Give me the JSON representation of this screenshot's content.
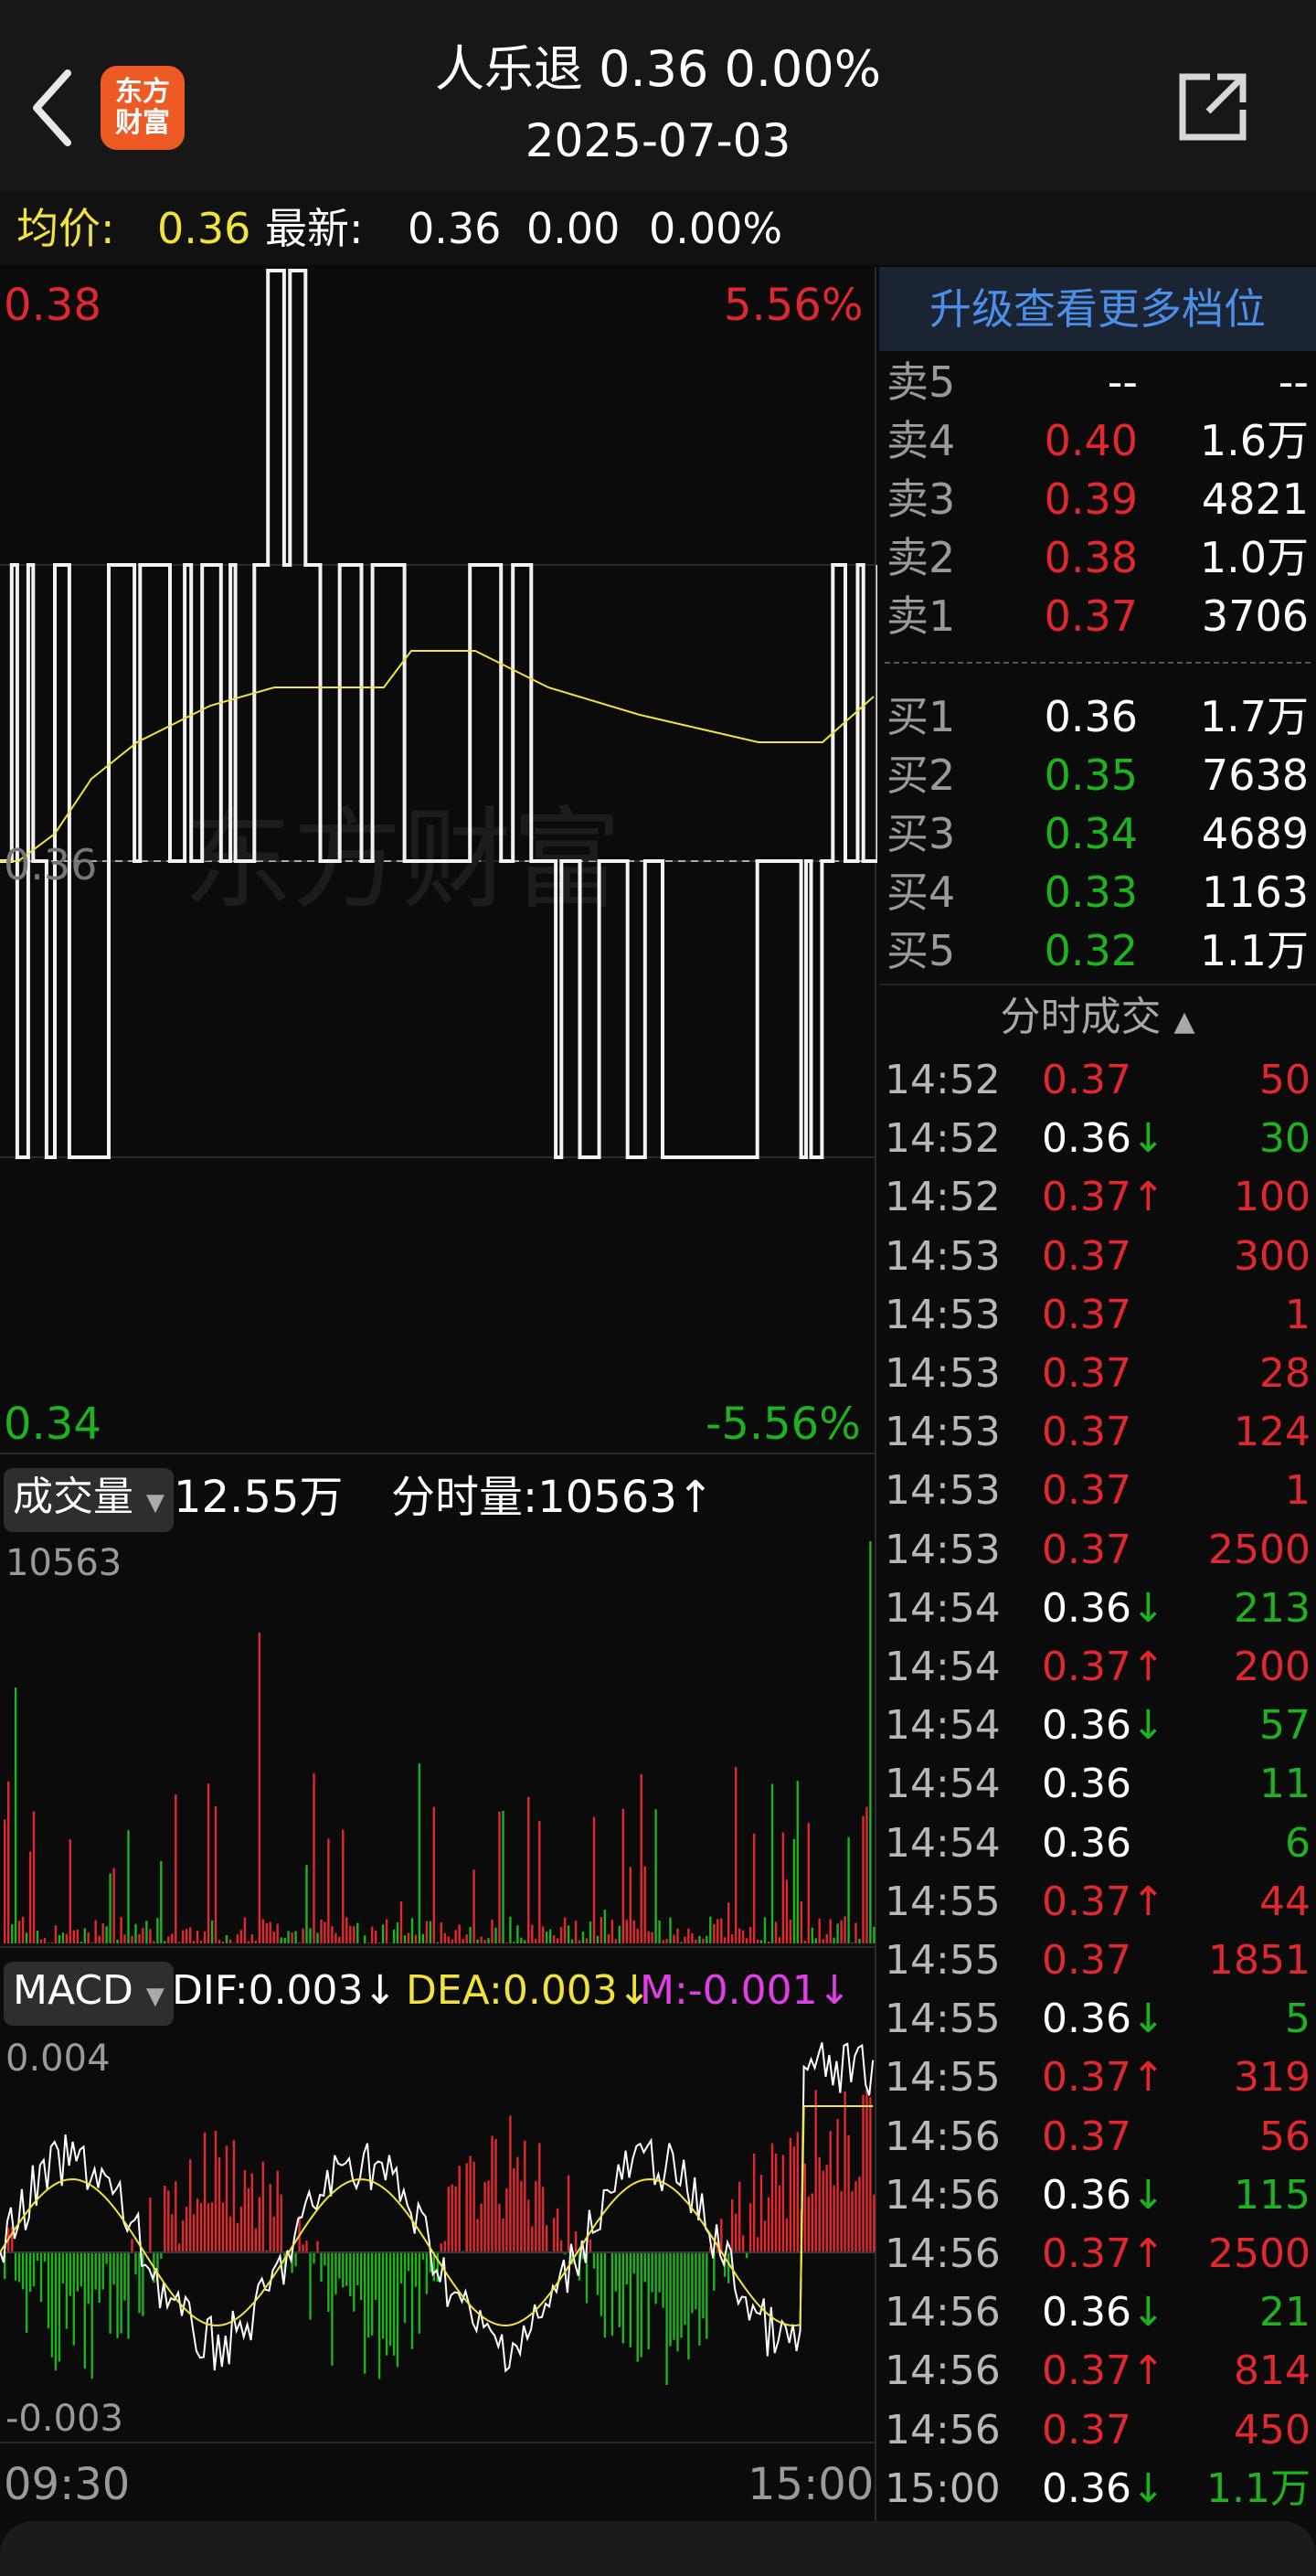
{
  "header": {
    "title": "人乐退  0.36  0.00%",
    "date": "2025-07-03",
    "logo_line1": "东方",
    "logo_line2": "财富",
    "back_icon": "chevron-left-icon",
    "share_icon": "share-external-icon"
  },
  "infobar": {
    "avg_label": "均价:",
    "avg_value": "0.36",
    "latest_label": "最新:",
    "latest_value": "0.36",
    "change": "0.00",
    "change_pct": "0.00%"
  },
  "price_chart": {
    "y_max_label": "0.38",
    "y_max_pct": "5.56%",
    "y_mid_label": "0.36",
    "y_min_label": "0.34",
    "y_min_pct": "-5.56%",
    "watermark": "东方财富"
  },
  "volume_panel": {
    "selector_label": "成交量",
    "total": "12.55万",
    "minute_volume": "分时量:10563↑",
    "max_label": "10563"
  },
  "macd_panel": {
    "selector_label": "MACD",
    "dif": "DIF:0.003↓",
    "dea": "DEA:0.003↓",
    "m": "M:-0.001↓",
    "max_label": "0.004",
    "min_label": "-0.003"
  },
  "time_axis": {
    "start": "09:30",
    "end": "15:00"
  },
  "order_book": {
    "upgrade_label": "升级查看更多档位",
    "asks": [
      {
        "label": "卖5",
        "price": "--",
        "volume": "--"
      },
      {
        "label": "卖4",
        "price": "0.40",
        "volume": "1.6万"
      },
      {
        "label": "卖3",
        "price": "0.39",
        "volume": "4821"
      },
      {
        "label": "卖2",
        "price": "0.38",
        "volume": "1.0万"
      },
      {
        "label": "卖1",
        "price": "0.37",
        "volume": "3706"
      }
    ],
    "bids": [
      {
        "label": "买1",
        "price": "0.36",
        "volume": "1.7万"
      },
      {
        "label": "买2",
        "price": "0.35",
        "volume": "7638"
      },
      {
        "label": "买3",
        "price": "0.34",
        "volume": "4689"
      },
      {
        "label": "买4",
        "price": "0.33",
        "volume": "1163"
      },
      {
        "label": "买5",
        "price": "0.32",
        "volume": "1.1万"
      }
    ]
  },
  "trades": {
    "header": "分时成交",
    "rows": [
      {
        "time": "14:52",
        "price": "0.37",
        "dir": "",
        "volume": "50",
        "color": "red"
      },
      {
        "time": "14:52",
        "price": "0.36",
        "dir": "↓",
        "volume": "30",
        "color": "green"
      },
      {
        "time": "14:52",
        "price": "0.37",
        "dir": "↑",
        "volume": "100",
        "color": "red"
      },
      {
        "time": "14:53",
        "price": "0.37",
        "dir": "",
        "volume": "300",
        "color": "red"
      },
      {
        "time": "14:53",
        "price": "0.37",
        "dir": "",
        "volume": "1",
        "color": "red"
      },
      {
        "time": "14:53",
        "price": "0.37",
        "dir": "",
        "volume": "28",
        "color": "red"
      },
      {
        "time": "14:53",
        "price": "0.37",
        "dir": "",
        "volume": "124",
        "color": "red"
      },
      {
        "time": "14:53",
        "price": "0.37",
        "dir": "",
        "volume": "1",
        "color": "red"
      },
      {
        "time": "14:53",
        "price": "0.37",
        "dir": "",
        "volume": "2500",
        "color": "red"
      },
      {
        "time": "14:54",
        "price": "0.36",
        "dir": "↓",
        "volume": "213",
        "color": "green"
      },
      {
        "time": "14:54",
        "price": "0.37",
        "dir": "↑",
        "volume": "200",
        "color": "red"
      },
      {
        "time": "14:54",
        "price": "0.36",
        "dir": "↓",
        "volume": "57",
        "color": "green"
      },
      {
        "time": "14:54",
        "price": "0.36",
        "dir": "",
        "volume": "11",
        "color": "green"
      },
      {
        "time": "14:54",
        "price": "0.36",
        "dir": "",
        "volume": "6",
        "color": "green"
      },
      {
        "time": "14:55",
        "price": "0.37",
        "dir": "↑",
        "volume": "44",
        "color": "red"
      },
      {
        "time": "14:55",
        "price": "0.37",
        "dir": "",
        "volume": "1851",
        "color": "red"
      },
      {
        "time": "14:55",
        "price": "0.36",
        "dir": "↓",
        "volume": "5",
        "color": "green"
      },
      {
        "time": "14:55",
        "price": "0.37",
        "dir": "↑",
        "volume": "319",
        "color": "red"
      },
      {
        "time": "14:56",
        "price": "0.37",
        "dir": "",
        "volume": "56",
        "color": "red"
      },
      {
        "time": "14:56",
        "price": "0.36",
        "dir": "↓",
        "volume": "115",
        "color": "green"
      },
      {
        "time": "14:56",
        "price": "0.37",
        "dir": "↑",
        "volume": "2500",
        "color": "red"
      },
      {
        "time": "14:56",
        "price": "0.36",
        "dir": "↓",
        "volume": "21",
        "color": "green"
      },
      {
        "time": "14:56",
        "price": "0.37",
        "dir": "↑",
        "volume": "814",
        "color": "red"
      },
      {
        "time": "14:56",
        "price": "0.37",
        "dir": "",
        "volume": "450",
        "color": "red"
      },
      {
        "time": "15:00",
        "price": "0.36",
        "dir": "↓",
        "volume": "1.1万",
        "color": "green"
      }
    ]
  },
  "colors": {
    "up": "#e0282e",
    "down": "#1fb21f",
    "avg_line": "#f2e23c",
    "price_line": "#ffffff",
    "macd_m": "#e23ee8"
  }
}
